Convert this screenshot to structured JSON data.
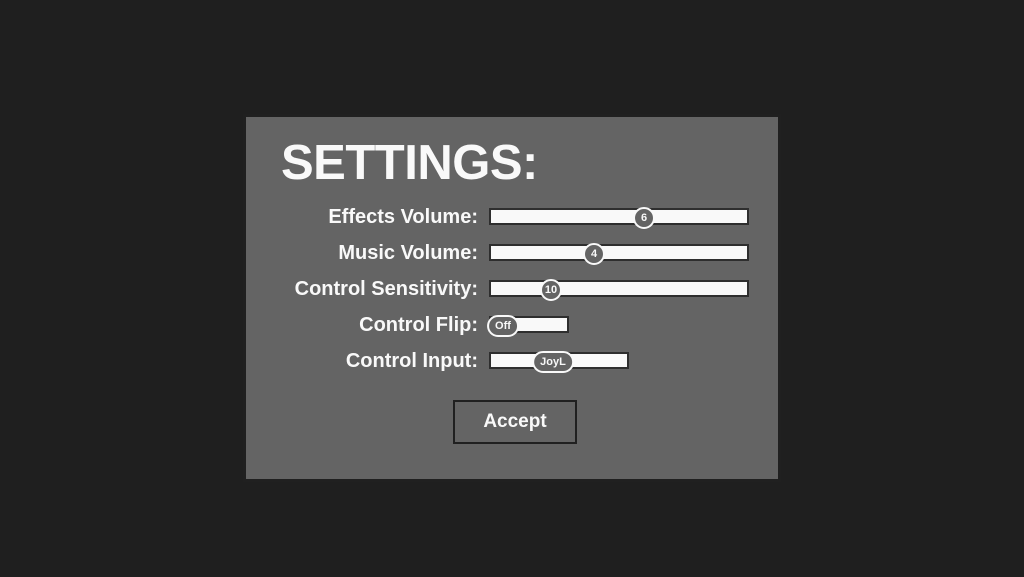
{
  "title": "SETTINGS:",
  "rows": {
    "effects": {
      "label": "Effects Volume:",
      "value": "6"
    },
    "music": {
      "label": "Music Volume:",
      "value": "4"
    },
    "sensitivity": {
      "label": "Control Sensitivity:",
      "value": "10"
    },
    "flip": {
      "label": "Control Flip:",
      "value": "Off"
    },
    "input": {
      "label": "Control Input:",
      "value": "JoyL"
    }
  },
  "accept": "Accept"
}
